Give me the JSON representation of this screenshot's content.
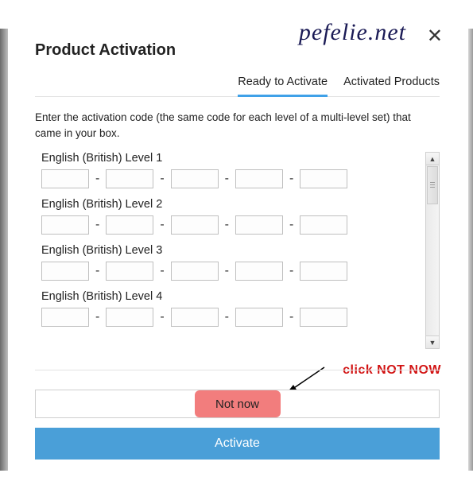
{
  "header": {
    "title": "Product Activation",
    "watermark": "pefelie.net",
    "tabs": [
      {
        "label": "Ready to Activate",
        "active": true
      },
      {
        "label": "Activated Products",
        "active": false
      }
    ]
  },
  "body": {
    "instructions": "Enter the activation code (the same code for each level of a multi-level set) that came in your box.",
    "levels": [
      {
        "label": "English (British) Level 1"
      },
      {
        "label": "English (British) Level 2"
      },
      {
        "label": "English (British) Level 3"
      },
      {
        "label": "English (British) Level 4"
      }
    ],
    "separator": "-"
  },
  "annotation": {
    "text": "click NOT NOW"
  },
  "footer": {
    "not_now": "Not now",
    "activate": "Activate"
  },
  "glyphs": {
    "close": "✕",
    "up": "▲",
    "down": "▼"
  }
}
